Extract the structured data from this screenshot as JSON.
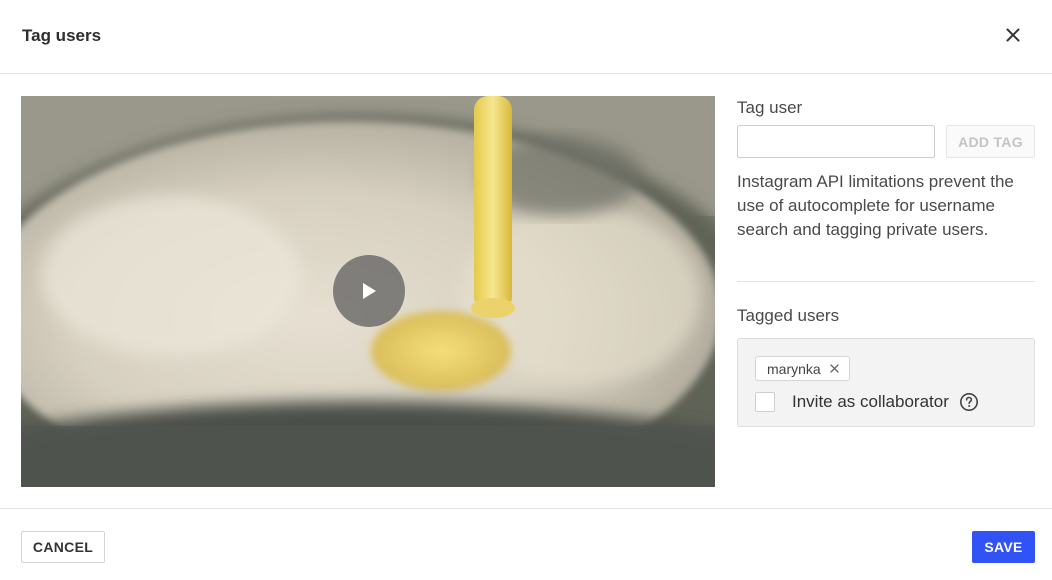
{
  "dialog": {
    "title": "Tag users"
  },
  "media": {
    "kind": "video",
    "play_icon": "play-icon"
  },
  "tag_user": {
    "label": "Tag user",
    "input_value": "",
    "input_placeholder": "",
    "add_button_label": "ADD TAG",
    "note": "Instagram API limitations prevent the use of autocomplete for username search and tagging private users."
  },
  "tagged_users": {
    "label": "Tagged users",
    "users": [
      {
        "username": "marynka"
      }
    ],
    "collaborator": {
      "label": "Invite as collaborator",
      "checked": false
    }
  },
  "footer": {
    "cancel_label": "CANCEL",
    "save_label": "SAVE"
  },
  "colors": {
    "primary": "#3152f5",
    "border": "#e3e3e3",
    "muted_text": "#c4c4c4"
  }
}
